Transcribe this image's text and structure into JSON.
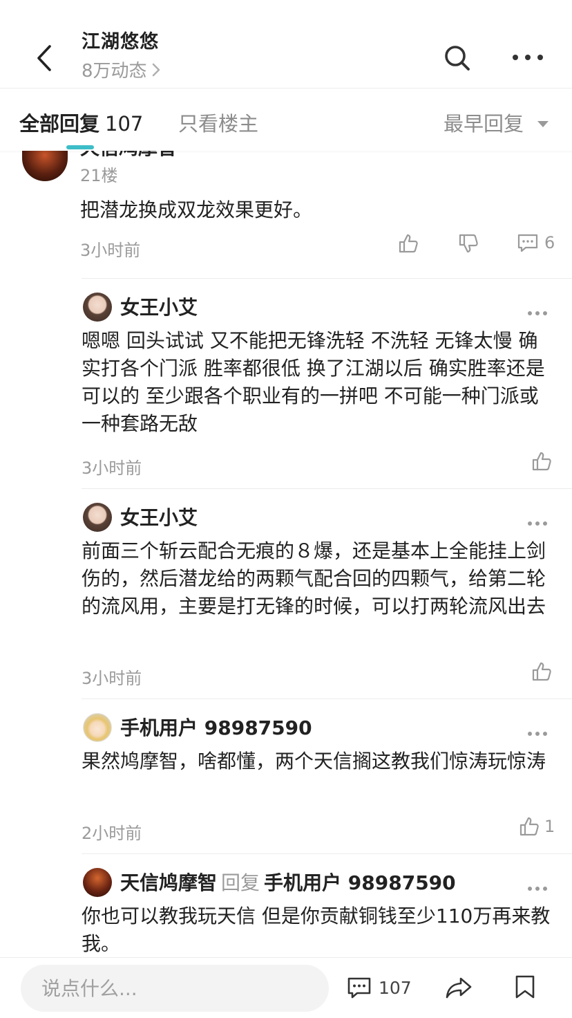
{
  "header": {
    "title": "江湖悠悠",
    "subtitle": "8万动态"
  },
  "tabs": {
    "all_label": "全部回复",
    "all_count": "107",
    "op_only_label": "只看楼主",
    "sort_label": "最早回复"
  },
  "floor": {
    "author": "天信鸠摩智",
    "number": "21楼",
    "text": "把潜龙换成双龙效果更好。",
    "time": "3小时前",
    "reply_count": "6"
  },
  "replies": [
    {
      "author": "女王小艾",
      "text": "嗯嗯 回头试试 又不能把无锋洗轻 不洗轻 无锋太慢 确实打各个门派 胜率都很低 换了江湖以后 确实胜率还是可以的 至少跟各个职业有的一拼吧 不可能一种门派或一种套路无敌",
      "time": "3小时前",
      "likes": ""
    },
    {
      "author": "女王小艾",
      "text": "前面三个斩云配合无痕的８爆，还是基本上全能挂上剑伤的，然后潜龙给的两颗气配合回的四颗气，给第二轮的流风用，主要是打无锋的时候，可以打两轮流风出去",
      "time": "3小时前",
      "likes": ""
    },
    {
      "author": "手机用户 98987590",
      "text": "果然鸠摩智，啥都懂，两个天信搁这教我们惊涛玩惊涛",
      "time": "2小时前",
      "likes": "1"
    },
    {
      "author": "天信鸠摩智",
      "reply_word": "回复",
      "reply_to": "手机用户 98987590",
      "text": "你也可以教我玩天信 但是你贡献铜钱至少110万再来教我。"
    }
  ],
  "bottom": {
    "input_placeholder": "说点什么...",
    "comment_count": "107"
  }
}
